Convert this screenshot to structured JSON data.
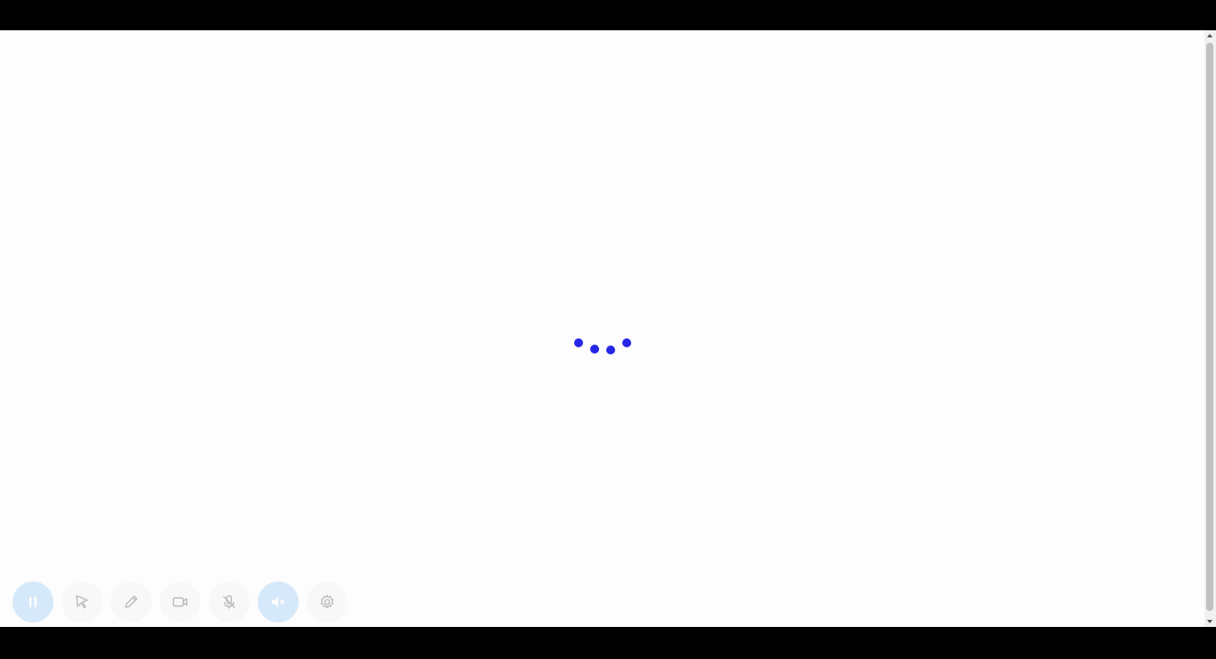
{
  "screen": {
    "state": "loading"
  },
  "loader": {
    "dot_color": "#2626e8",
    "dot_count": 4
  },
  "toolbar": {
    "buttons": [
      {
        "name": "pause-button",
        "icon": "pause-icon",
        "style": "primary"
      },
      {
        "name": "pointer-button",
        "icon": "cursor-pointer-icon",
        "style": "normal"
      },
      {
        "name": "pen-button",
        "icon": "pencil-icon",
        "style": "normal"
      },
      {
        "name": "camera-button",
        "icon": "video-camera-icon",
        "style": "normal"
      },
      {
        "name": "mic-button",
        "icon": "mic-off-icon",
        "style": "normal"
      },
      {
        "name": "speaker-button",
        "icon": "speaker-icon",
        "style": "primary"
      },
      {
        "name": "settings-button",
        "icon": "gear-icon",
        "style": "normal"
      }
    ],
    "accent_color": "#a9d3f7"
  }
}
